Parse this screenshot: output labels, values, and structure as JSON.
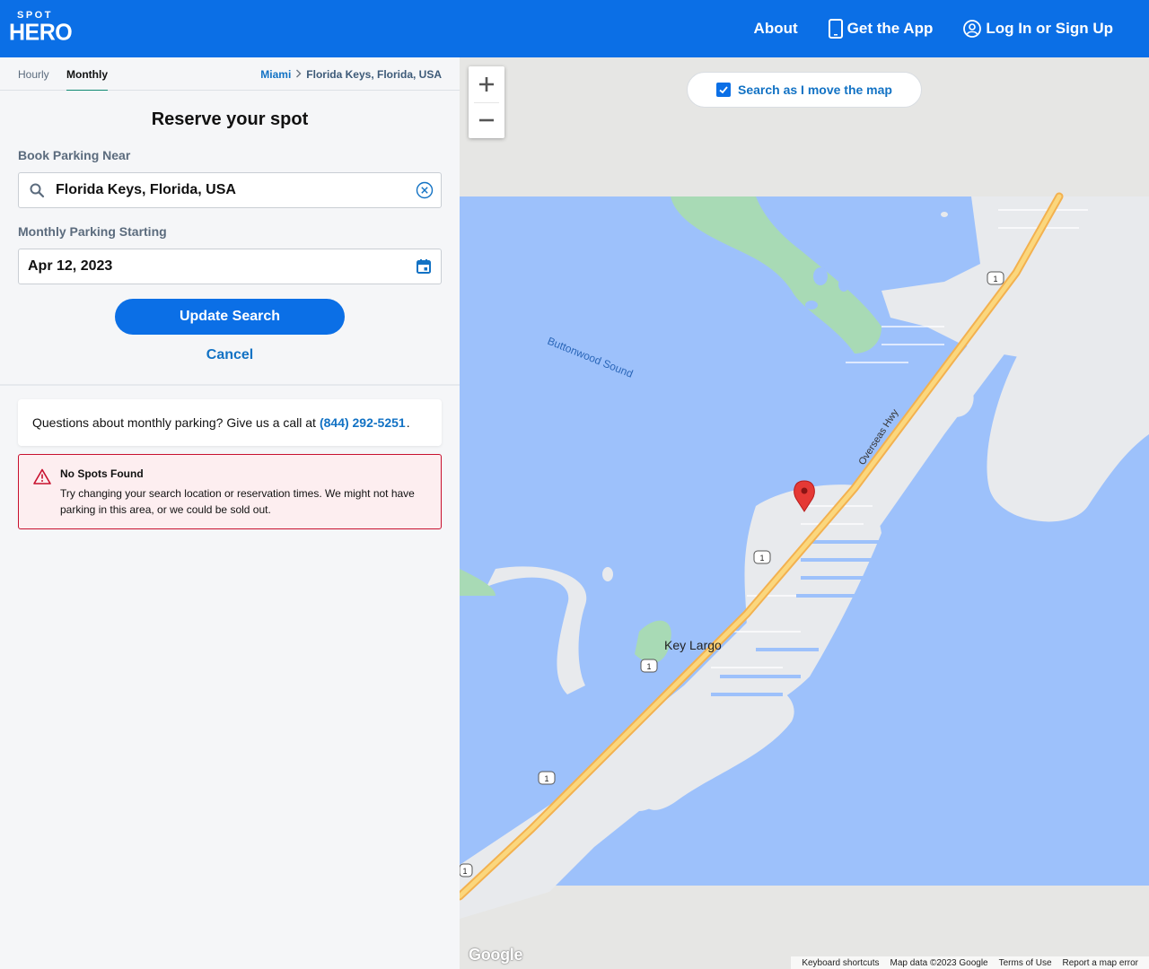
{
  "header": {
    "logo_top": "SPOT",
    "logo_bottom": "HERO",
    "nav": {
      "about": "About",
      "get_app": "Get the App",
      "login": "Log In or Sign Up"
    }
  },
  "tabs": {
    "hourly": "Hourly",
    "monthly": "Monthly",
    "active": "monthly"
  },
  "breadcrumb": {
    "parent": "Miami",
    "current": "Florida Keys, Florida, USA"
  },
  "form": {
    "title": "Reserve your spot",
    "location_label": "Book Parking Near",
    "location_value": "Florida Keys, Florida, USA",
    "date_label": "Monthly Parking Starting",
    "date_value": "Apr 12, 2023",
    "update_button": "Update Search",
    "cancel_button": "Cancel"
  },
  "info": {
    "text": "Questions about monthly parking? Give us a call at",
    "phone": "(844) 292-5251",
    "suffix": "."
  },
  "alert": {
    "title": "No Spots Found",
    "body": "Try changing your search location or reservation times. We might not have parking in this area, or we could be sold out."
  },
  "map": {
    "search_as_move": "Search as I move the map",
    "search_as_move_checked": true,
    "labels": {
      "sound": "Buttonwood Sound",
      "town": "Key Largo",
      "highway": "Overseas Hwy",
      "route": "1"
    },
    "footer": {
      "shortcuts": "Keyboard shortcuts",
      "data": "Map data ©2023 Google",
      "terms": "Terms of Use",
      "report": "Report a map error"
    },
    "brand": "Google"
  },
  "colors": {
    "brand_blue": "#0b6fe6",
    "link_blue": "#1272c4",
    "water": "#9dc1fb",
    "land": "#e8eaed",
    "road": "#f5c85a",
    "park": "#a8dab5",
    "pin": "#e53935",
    "alert_border": "#c8102e",
    "alert_bg": "#fdeef0"
  }
}
